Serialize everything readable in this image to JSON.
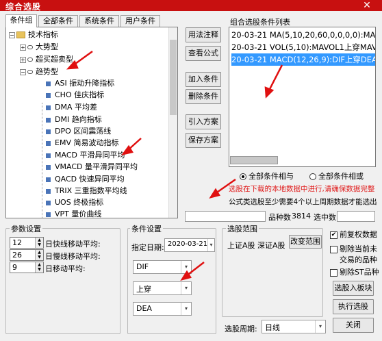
{
  "window": {
    "title": "综合选股",
    "close": "✕"
  },
  "tabs": [
    "条件组",
    "全部条件",
    "系统条件",
    "用户条件"
  ],
  "tree": {
    "root": "技术指标",
    "groups": [
      "大势型",
      "超买超卖型",
      "趋势型"
    ],
    "items": [
      "ASI 振动升降指标",
      "CHO 佳庆指标",
      "DMA 平均差",
      "DMI 趋向指标",
      "DPO 区间震荡线",
      "EMV 简易波动指标",
      "MACD 平滑异同平均",
      "VMACD 量平滑异同平均",
      "QACD 快速异同平均",
      "TRIX 三重指数平均线",
      "UOS 终极指标",
      "VPT 量价曲线"
    ]
  },
  "buttons": {
    "usage": "用法注释",
    "formula": "查看公式",
    "add": "加入条件",
    "delete": "删除条件",
    "import": "引入方案",
    "save": "保存方案",
    "change_range": "改变范围",
    "to_block": "选股入板块",
    "run": "执行选股",
    "close": "关闭"
  },
  "condition_list": {
    "label": "组合选股条件列表",
    "items": [
      "20-03-21 MA(5,10,20,60,0,0,0,0):MA1_",
      "20-03-21 VOL(5,10):MAVOL1上穿MAVOL",
      "20-03-21 MACD(12,26,9):DIF上穿DEA"
    ]
  },
  "logic": {
    "and": "全部条件相与",
    "or": "全部条件相或"
  },
  "warning_red": "选股在下载的本地数据中进行,请确保数据完整",
  "warning_black": "公式类选股至少需要4个以上周期数据才能选出",
  "counts": {
    "label_count": "品种数",
    "count": "3814",
    "label_selected": "选中数",
    "selected": ""
  },
  "params": {
    "title": "参数设置",
    "rows": [
      {
        "value": "12",
        "label": "日快线移动平均:"
      },
      {
        "value": "26",
        "label": "日慢线移动平均:"
      },
      {
        "value": "9",
        "label": "日移动平均:"
      }
    ]
  },
  "cond_settings": {
    "title": "条件设置",
    "date_label": "指定日期:",
    "date": "2020-03-21",
    "line1": "DIF",
    "op": "上穿",
    "line2": "DEA"
  },
  "range": {
    "title": "选股范围",
    "markets": "上证A股 深证A股"
  },
  "checks": {
    "restore": "前复权数据",
    "exclude_new": "剔除当前未",
    "exclude_new2": "交易的品种",
    "exclude_st": "剔除ST品种"
  },
  "period": {
    "label": "选股周期:",
    "value": "日线"
  },
  "colors": {
    "title_bg": "#c81010",
    "selection": "#3399ff",
    "arrow": "#e01010"
  }
}
